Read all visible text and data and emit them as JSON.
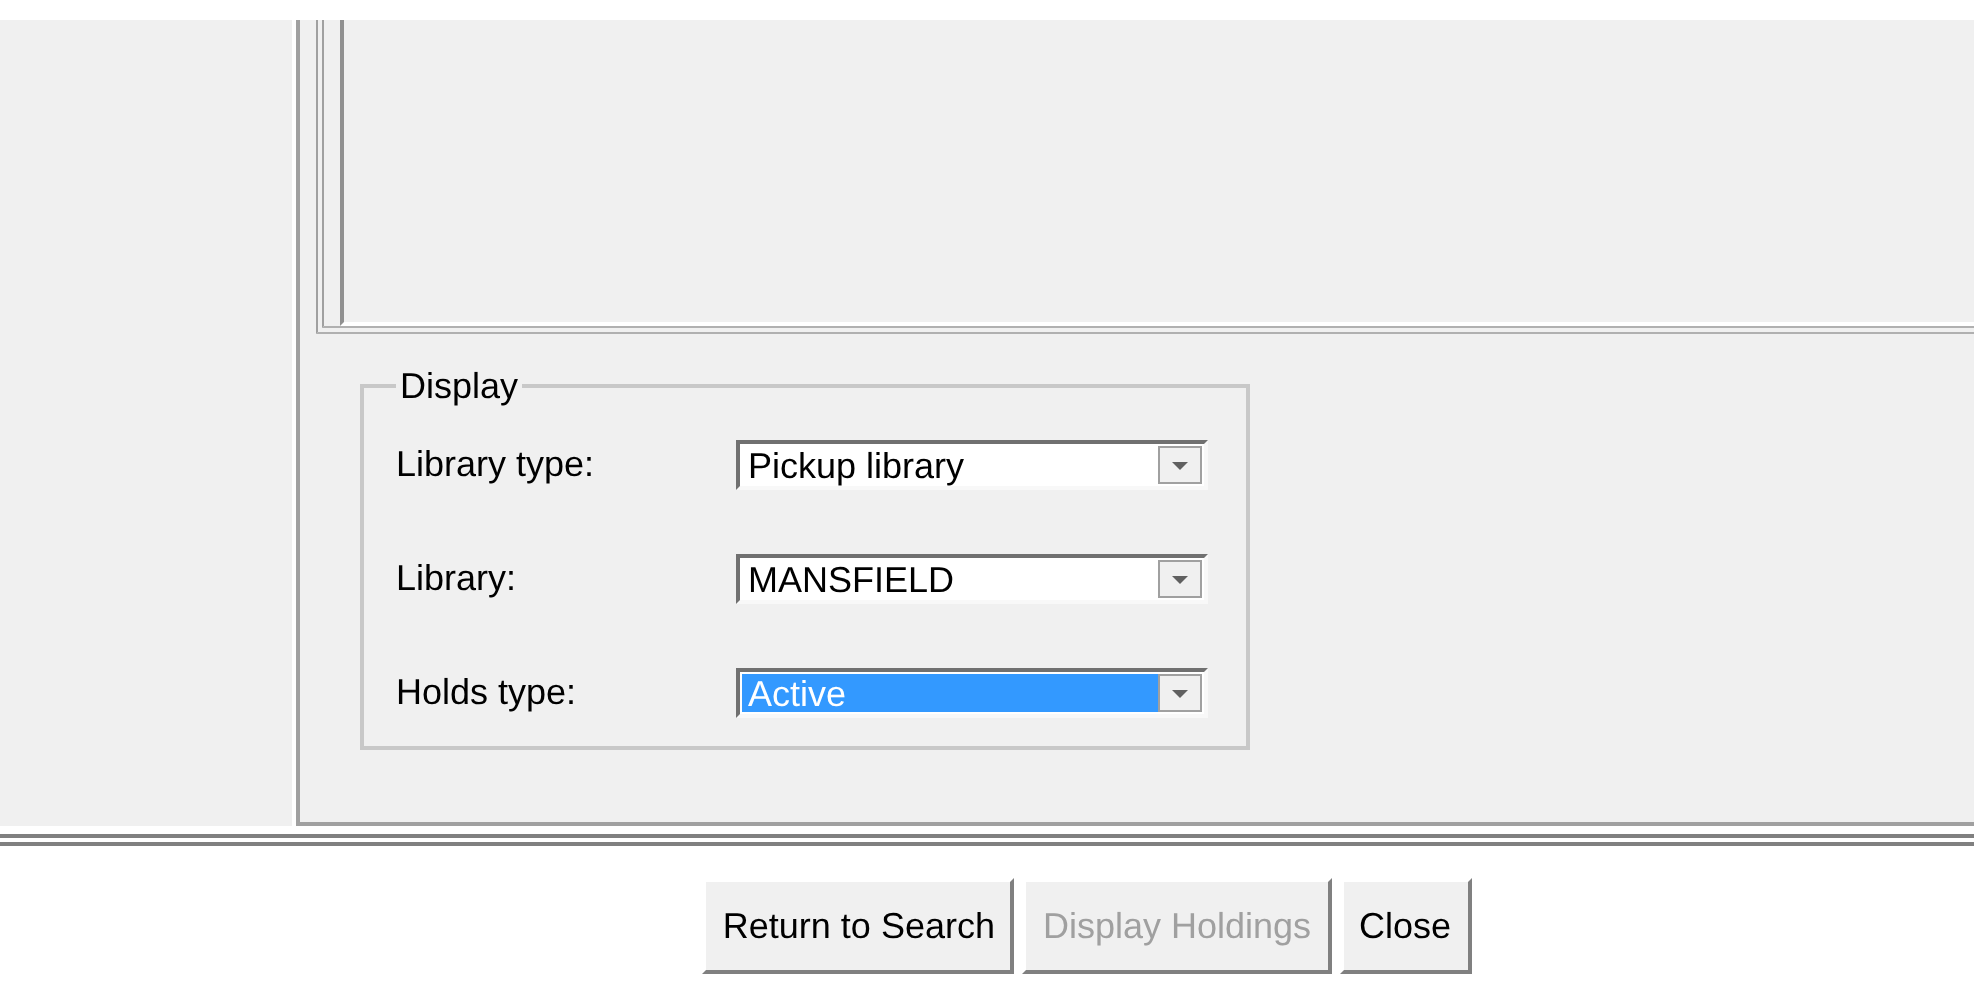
{
  "display_group": {
    "title": "Display",
    "fields": [
      {
        "label": "Library type:",
        "value": "Pickup library",
        "selected": false
      },
      {
        "label": "Library:",
        "value": "MANSFIELD",
        "selected": false
      },
      {
        "label": "Holds type:",
        "value": "Active",
        "selected": true
      }
    ]
  },
  "buttons": [
    {
      "label": "Return to Search",
      "disabled": false
    },
    {
      "label": "Display Holdings",
      "disabled": true
    },
    {
      "label": "Close",
      "disabled": false
    }
  ]
}
